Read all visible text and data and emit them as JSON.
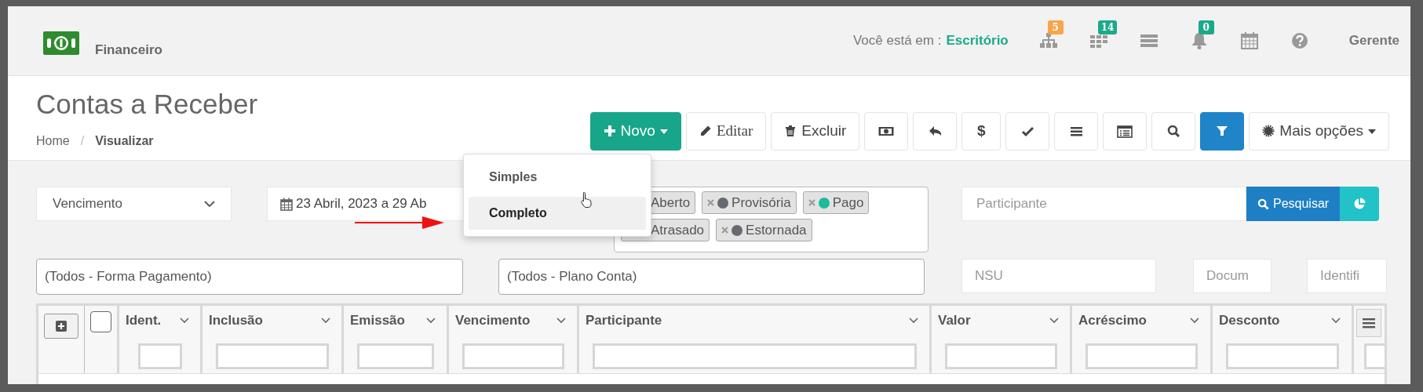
{
  "app": {
    "title": "Financeiro"
  },
  "location": {
    "label": "Você está em :",
    "value": "Escritório"
  },
  "header_icons": [
    {
      "kind": "sitemap",
      "badge": "5",
      "color": "#f7a54a"
    },
    {
      "kind": "grid",
      "badge": "14",
      "color": "#1aaa8a"
    },
    {
      "kind": "server"
    },
    {
      "kind": "bell",
      "badge": "0",
      "color": "#1aaa8a"
    },
    {
      "kind": "calendar"
    },
    {
      "kind": "help"
    }
  ],
  "user": "Gerente",
  "page": {
    "title": "Contas a Receber",
    "breadcrumb_separator": "/",
    "breadcrumb": [
      {
        "label": "Home",
        "current": false
      },
      {
        "label": "Visualizar",
        "current": true
      }
    ]
  },
  "toolbar": [
    {
      "kind": "new",
      "label": "Novo",
      "active": false
    },
    {
      "kind": "edit",
      "label": "Editar",
      "active": false
    },
    {
      "kind": "delete",
      "label": "Excluir",
      "active": false
    },
    {
      "kind": "money",
      "active": false
    },
    {
      "kind": "undo",
      "active": false
    },
    {
      "kind": "dollar",
      "label": "$",
      "active": false
    },
    {
      "kind": "check",
      "active": false
    },
    {
      "kind": "list",
      "active": false
    },
    {
      "kind": "card",
      "active": false
    },
    {
      "kind": "search",
      "active": false
    },
    {
      "kind": "filter",
      "active": true
    },
    {
      "kind": "more",
      "label": "Mais opções",
      "active": false
    }
  ],
  "new_menu": [
    {
      "label": "Simples",
      "selected": false
    },
    {
      "label": "Completo",
      "selected": true
    }
  ],
  "filters": {
    "date_type": "Vencimento",
    "period": "23 Abril, 2023 a 29 Ab",
    "statuses": [
      {
        "label": "Aberto"
      },
      {
        "label": "Provisória",
        "color": "#666a70"
      },
      {
        "label": "Pago",
        "color": "#1abc9c"
      },
      {
        "label": "Atrasado"
      },
      {
        "label": "Estornada",
        "color": "#666a70"
      }
    ],
    "participant": {
      "placeholder": "Participante"
    },
    "search_button": "Pesquisar",
    "payment_method": "(Todos - Forma Pagamento)",
    "account_plan": "(Todos - Plano Conta)",
    "nsu": {
      "placeholder": "NSU"
    },
    "document": {
      "placeholder": "Docum"
    },
    "identifier": {
      "placeholder": "Identifi"
    }
  },
  "table": {
    "select_all": {
      "checked": false
    },
    "columns": [
      {
        "label": "Ident."
      },
      {
        "label": "Inclusão"
      },
      {
        "label": "Emissão"
      },
      {
        "label": "Vencimento"
      },
      {
        "label": "Participante"
      },
      {
        "label": "Valor"
      },
      {
        "label": "Acréscimo"
      },
      {
        "label": "Desconto"
      }
    ]
  }
}
